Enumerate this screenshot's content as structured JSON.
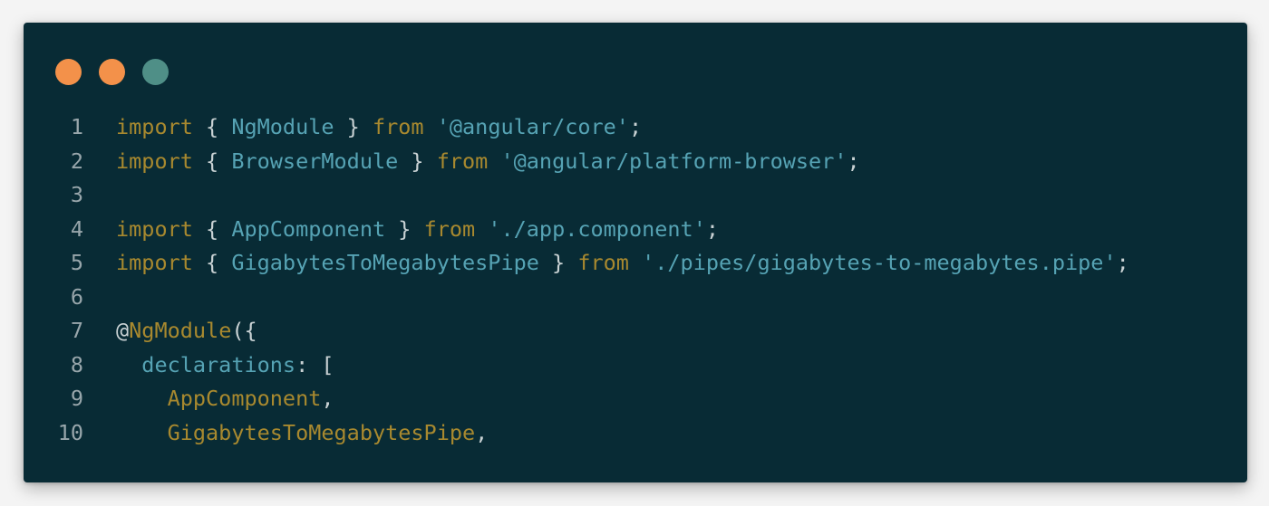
{
  "window": {
    "dots": [
      {
        "name": "close-dot",
        "color": "#f3914a"
      },
      {
        "name": "minimize-dot",
        "color": "#f3914a"
      },
      {
        "name": "maximize-dot",
        "color": "#4f8f87"
      }
    ]
  },
  "colors": {
    "background": "#082b35",
    "keyword": "#a8892f",
    "identifier": "#56a3b4",
    "punctuation": "#c9d2d4",
    "line_number": "#98a6ab"
  },
  "code": {
    "lines": [
      {
        "n": "1",
        "tokens": [
          [
            "kw",
            "import"
          ],
          [
            "pn",
            " { "
          ],
          [
            "id",
            "NgModule"
          ],
          [
            "pn",
            " } "
          ],
          [
            "kw",
            "from"
          ],
          [
            "pn",
            " "
          ],
          [
            "str",
            "'@angular/core'"
          ],
          [
            "pn",
            ";"
          ]
        ]
      },
      {
        "n": "2",
        "tokens": [
          [
            "kw",
            "import"
          ],
          [
            "pn",
            " { "
          ],
          [
            "id",
            "BrowserModule"
          ],
          [
            "pn",
            " } "
          ],
          [
            "kw",
            "from"
          ],
          [
            "pn",
            " "
          ],
          [
            "str",
            "'@angular/platform-browser'"
          ],
          [
            "pn",
            ";"
          ]
        ]
      },
      {
        "n": "3",
        "tokens": []
      },
      {
        "n": "4",
        "tokens": [
          [
            "kw",
            "import"
          ],
          [
            "pn",
            " { "
          ],
          [
            "id",
            "AppComponent"
          ],
          [
            "pn",
            " } "
          ],
          [
            "kw",
            "from"
          ],
          [
            "pn",
            " "
          ],
          [
            "str",
            "'./app.component'"
          ],
          [
            "pn",
            ";"
          ]
        ]
      },
      {
        "n": "5",
        "tokens": [
          [
            "kw",
            "import"
          ],
          [
            "pn",
            " { "
          ],
          [
            "id",
            "GigabytesToMegabytesPipe"
          ],
          [
            "pn",
            " } "
          ],
          [
            "kw",
            "from"
          ],
          [
            "pn",
            " "
          ],
          [
            "str",
            "'./pipes/gigabytes-to-megabytes.pipe'"
          ],
          [
            "pn",
            ";"
          ]
        ]
      },
      {
        "n": "6",
        "tokens": []
      },
      {
        "n": "7",
        "tokens": [
          [
            "pn",
            "@"
          ],
          [
            "ann",
            "NgModule"
          ],
          [
            "pn",
            "({"
          ]
        ]
      },
      {
        "n": "8",
        "tokens": [
          [
            "pn",
            "  "
          ],
          [
            "id",
            "declarations"
          ],
          [
            "pn",
            ": ["
          ]
        ]
      },
      {
        "n": "9",
        "tokens": [
          [
            "pn",
            "    "
          ],
          [
            "ann",
            "AppComponent"
          ],
          [
            "pn",
            ","
          ]
        ]
      },
      {
        "n": "10",
        "tokens": [
          [
            "pn",
            "    "
          ],
          [
            "ann",
            "GigabytesToMegabytesPipe"
          ],
          [
            "pn",
            ","
          ]
        ]
      }
    ]
  }
}
